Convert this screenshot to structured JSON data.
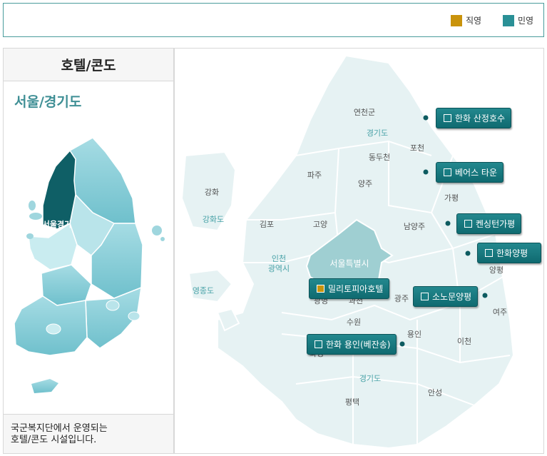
{
  "legend": {
    "direct": {
      "label": "직영",
      "color": "#c9930b"
    },
    "private": {
      "label": "민영",
      "color": "#2a9096"
    }
  },
  "left": {
    "title": "호텔/콘도",
    "region": "서울/경기도",
    "map_selected_label": "서울경기",
    "footer_line1": "국군복지단에서 운영되는",
    "footer_line2": "호텔/콘도 시설입니다."
  },
  "map": {
    "labels": {
      "yeoncheon": "연천군",
      "gyeonggi_top": "경기도",
      "pocheon": "포천",
      "dongducheon": "동두천",
      "paju": "파주",
      "yangju": "양주",
      "gapyeong": "가평",
      "ganghwa": "강화",
      "ganghwado": "강화도",
      "gimpo": "김포",
      "goyang": "고양",
      "namyangju": "남양주",
      "incheon": "인천\n광역시",
      "seoul": "서울특별시",
      "yangpyeong": "양평",
      "yeongjongdo": "영종도",
      "gwangmyeong": "광명",
      "gwacheon": "과천",
      "gwangju": "광주",
      "yeoju": "여주",
      "suwon": "수원",
      "yongin": "용인",
      "icheon": "이천",
      "hwaseong": "화성",
      "gyeonggi_bottom": "경기도",
      "pyeongtaek": "평택",
      "anseong": "안성"
    },
    "hotels": [
      {
        "id": "hanwha-sanjeong",
        "name": "한화 산정호수",
        "type": "private"
      },
      {
        "id": "bears-town",
        "name": "베어스 타운",
        "type": "private"
      },
      {
        "id": "kensington-gapyeong",
        "name": "켄싱턴가평",
        "type": "private"
      },
      {
        "id": "hanwha-yangpyeong",
        "name": "한화양평",
        "type": "private"
      },
      {
        "id": "military-hotel",
        "name": "밀리토피아호텔",
        "type": "direct"
      },
      {
        "id": "snow-yangpyeong",
        "name": "소노문양평",
        "type": "private"
      },
      {
        "id": "hanwha-yongin",
        "name": "한화 용인(베잔송)",
        "type": "private"
      }
    ]
  }
}
